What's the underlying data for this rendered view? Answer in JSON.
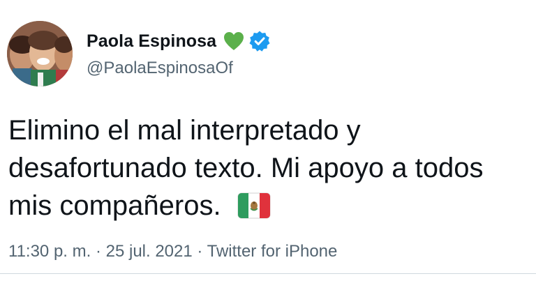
{
  "tweet": {
    "display_name": "Paola Espinosa",
    "handle": "@PaolaEspinosaOf",
    "text": "Elimino el mal interpretado y\ndesafortunado texto. Mi apoyo a todos\nmis compañeros. ",
    "timestamp": "11:30 p. m. · 25 jul. 2021 · Twitter for iPhone"
  },
  "icons": {
    "heart": "green-heart-icon",
    "verified": "verified-badge-icon",
    "flag": "mexico-flag-icon"
  },
  "colors": {
    "heart": "#5bb04b",
    "verified": "#1d9bf0",
    "secondary_text": "#536471",
    "flag_green": "#2e9c5e",
    "flag_red": "#e0323c"
  }
}
